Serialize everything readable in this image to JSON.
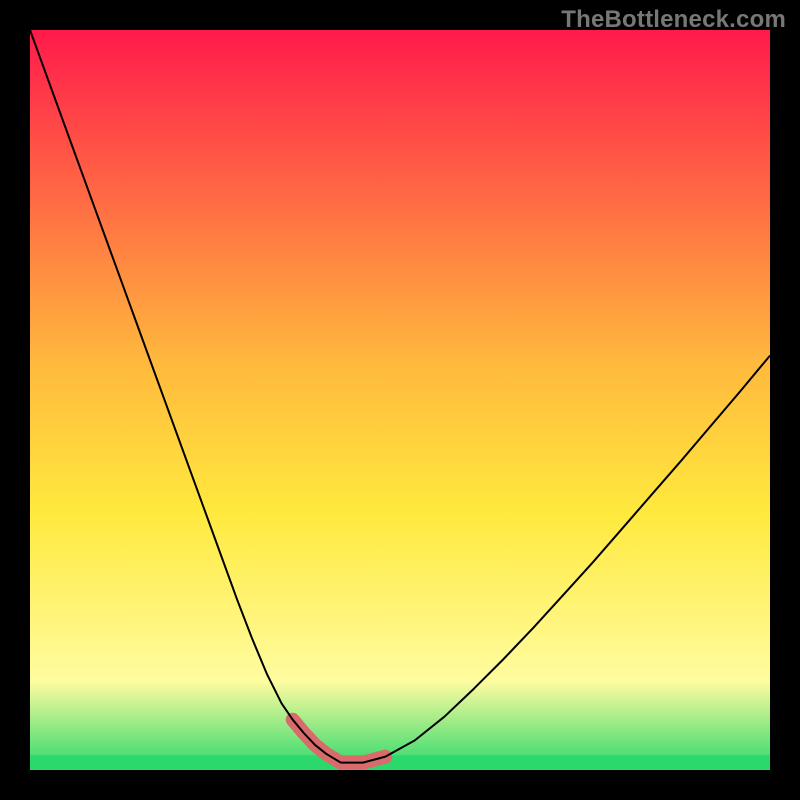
{
  "watermark": "TheBottleneck.com",
  "colors": {
    "gradient_top": "#ff1a4b",
    "gradient_mid_upper": "#ffb93d",
    "gradient_mid": "#ffe93d",
    "gradient_lower": "#fffca0",
    "gradient_bottom": "#2bd86b",
    "curve": "#000000",
    "highlight": "#d96b6b",
    "frame": "#000000"
  },
  "chart_data": {
    "type": "line",
    "title": "",
    "xlabel": "",
    "ylabel": "",
    "xlim": [
      0,
      1
    ],
    "ylim": [
      0,
      1
    ],
    "x": [
      0.0,
      0.02,
      0.04,
      0.06,
      0.08,
      0.1,
      0.12,
      0.14,
      0.16,
      0.18,
      0.2,
      0.22,
      0.24,
      0.26,
      0.28,
      0.3,
      0.32,
      0.34,
      0.355,
      0.37,
      0.385,
      0.4,
      0.41,
      0.42,
      0.43,
      0.45,
      0.48,
      0.52,
      0.56,
      0.6,
      0.64,
      0.68,
      0.72,
      0.76,
      0.8,
      0.84,
      0.88,
      0.92,
      0.96,
      1.0
    ],
    "y": [
      1.0,
      0.945,
      0.89,
      0.835,
      0.78,
      0.725,
      0.67,
      0.615,
      0.56,
      0.505,
      0.45,
      0.395,
      0.34,
      0.285,
      0.23,
      0.178,
      0.13,
      0.09,
      0.068,
      0.05,
      0.034,
      0.022,
      0.016,
      0.01,
      0.01,
      0.01,
      0.018,
      0.04,
      0.072,
      0.11,
      0.15,
      0.192,
      0.236,
      0.28,
      0.326,
      0.372,
      0.418,
      0.465,
      0.512,
      0.56
    ],
    "highlight_x": [
      0.355,
      0.37,
      0.385,
      0.4,
      0.41,
      0.42,
      0.43,
      0.45,
      0.48
    ],
    "highlight_y": [
      0.068,
      0.05,
      0.034,
      0.022,
      0.016,
      0.01,
      0.01,
      0.01,
      0.018
    ],
    "good_band_y": [
      0.0,
      0.02
    ]
  }
}
